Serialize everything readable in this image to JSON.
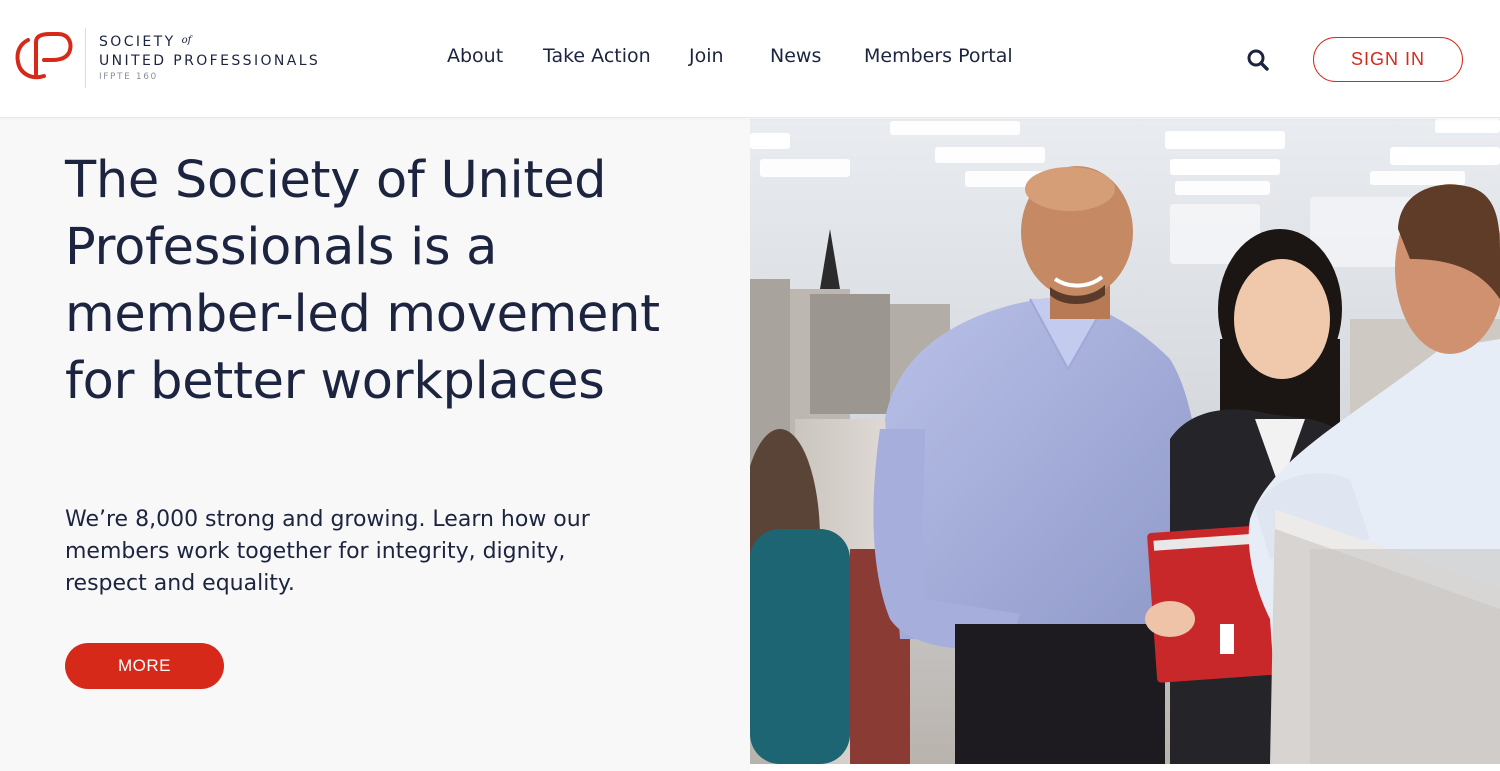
{
  "brand": {
    "line1": "SOCIETY",
    "line1_of": "of",
    "line2": "UNITED PROFESSIONALS",
    "line3": "IFPTE 160",
    "accent_color": "#d7291a",
    "text_color": "#1c2440"
  },
  "nav": {
    "items": [
      {
        "label": "About"
      },
      {
        "label": "Take Action"
      },
      {
        "label": "Join"
      },
      {
        "label": "News"
      },
      {
        "label": "Members Portal"
      }
    ]
  },
  "header": {
    "search_icon": "search-icon",
    "signin_label": "SIGN IN"
  },
  "hero": {
    "title": "The Society of United Professionals is a member-led movement for better workplaces",
    "subtitle": "We’re 8,000 strong and growing. Learn how our members work together for integrity, dignity, respect and equality.",
    "cta_label": "MORE",
    "image_subject": "office-colleagues-photo"
  }
}
